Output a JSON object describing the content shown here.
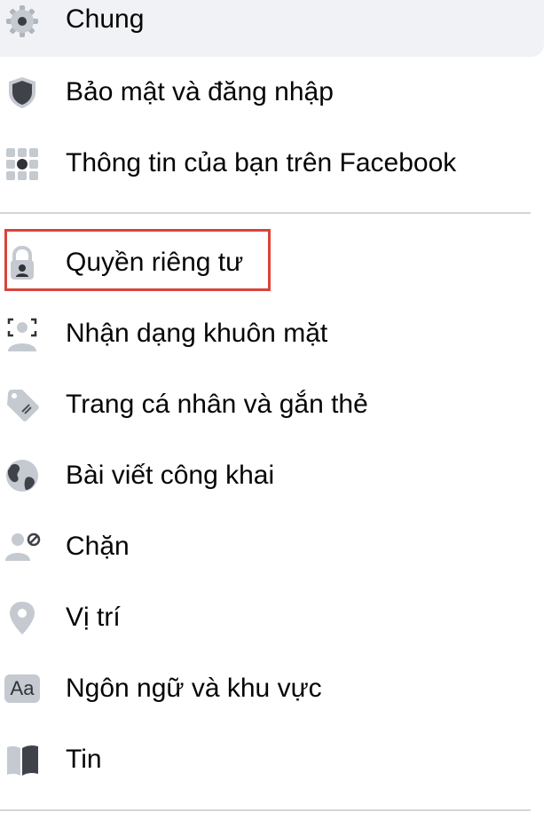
{
  "menu": {
    "items": [
      {
        "label": "Chung",
        "icon": "gear-icon"
      },
      {
        "label": "Bảo mật và đăng nhập",
        "icon": "shield-icon"
      },
      {
        "label": "Thông tin của bạn trên Facebook",
        "icon": "grid-icon"
      },
      {
        "label": "Quyền riêng tư",
        "icon": "lock-icon"
      },
      {
        "label": "Nhận dạng khuôn mặt",
        "icon": "face-recognition-icon"
      },
      {
        "label": "Trang cá nhân và gắn thẻ",
        "icon": "tag-icon"
      },
      {
        "label": "Bài viết công khai",
        "icon": "globe-icon"
      },
      {
        "label": "Chặn",
        "icon": "block-user-icon"
      },
      {
        "label": "Vị trí",
        "icon": "location-pin-icon"
      },
      {
        "label": "Ngôn ngữ và khu vực",
        "icon": "language-icon"
      },
      {
        "label": "Tin",
        "icon": "stories-book-icon"
      }
    ],
    "language_icon_text": "Aa"
  },
  "colors": {
    "highlight_border": "#d9433b",
    "selected_background": "#f0f2f5",
    "icon_gray": "#8d949e",
    "icon_dark": "#4b4f56"
  }
}
